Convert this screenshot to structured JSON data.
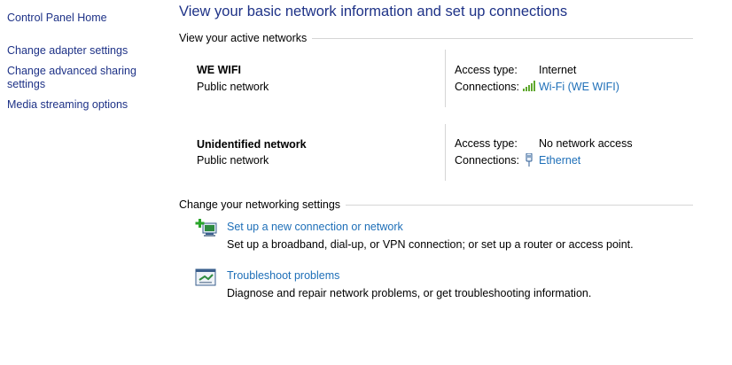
{
  "sidebar": {
    "items": [
      {
        "label": "Control Panel Home"
      },
      {
        "label": "Change adapter settings"
      },
      {
        "label": "Change advanced sharing settings"
      },
      {
        "label": "Media streaming options"
      }
    ]
  },
  "main": {
    "title": "View your basic network information and set up connections",
    "active_networks_heading": "View your active networks",
    "networks": [
      {
        "name": "WE WIFI",
        "category": "Public network",
        "access_type_label": "Access type:",
        "access_type_value": "Internet",
        "connections_label": "Connections:",
        "connection_link": "Wi-Fi (WE WIFI)",
        "icon": "wifi-signal-icon"
      },
      {
        "name": "Unidentified network",
        "category": "Public network",
        "access_type_label": "Access type:",
        "access_type_value": "No network access",
        "connections_label": "Connections:",
        "connection_link": "Ethernet",
        "icon": "ethernet-icon"
      }
    ],
    "settings_heading": "Change your networking settings",
    "tasks": [
      {
        "link": "Set up a new connection or network",
        "description": "Set up a broadband, dial-up, or VPN connection; or set up a router or access point.",
        "icon": "new-connection-icon"
      },
      {
        "link": "Troubleshoot problems",
        "description": "Diagnose and repair network problems, or get troubleshooting information.",
        "icon": "troubleshoot-icon"
      }
    ]
  },
  "colors": {
    "sidebar_link": "#1e3287",
    "title": "#1e3287",
    "link": "#1e6fb8",
    "rule": "#d5d5d5"
  }
}
